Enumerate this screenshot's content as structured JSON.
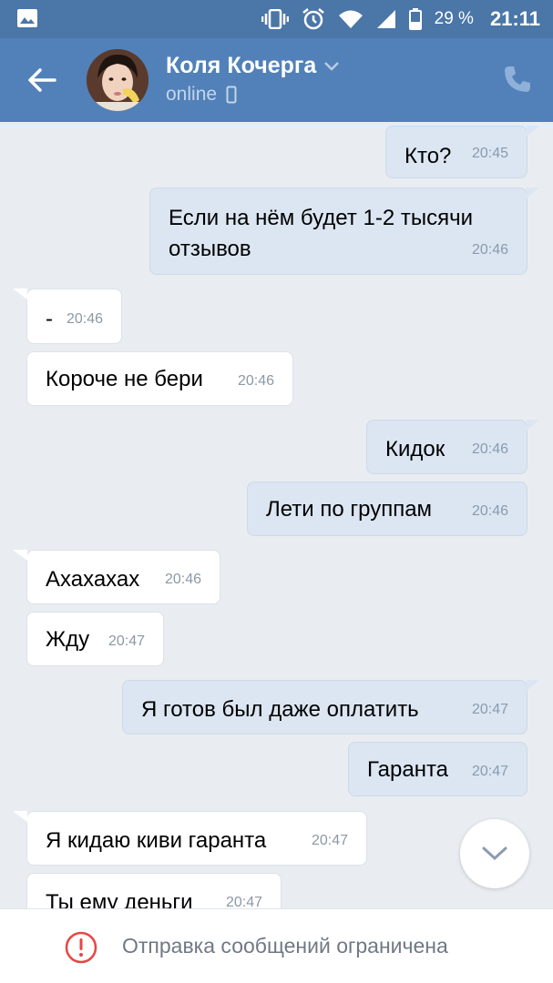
{
  "status_bar": {
    "battery_percent": "29 %",
    "time": "21:11"
  },
  "header": {
    "contact_name": "Коля Кочерга",
    "status": "online"
  },
  "messages": [
    {
      "dir": "out",
      "text": "Кто?",
      "time": "20:45"
    },
    {
      "dir": "out",
      "text": "Если на нём будет 1-2 тысячи отзывов",
      "time": "20:46"
    },
    {
      "dir": "in",
      "text": "-",
      "time": "20:46"
    },
    {
      "dir": "in",
      "text": "Короче не бери",
      "time": "20:46"
    },
    {
      "dir": "out",
      "text": "Кидок",
      "time": "20:46"
    },
    {
      "dir": "out",
      "text": "Лети по группам",
      "time": "20:46"
    },
    {
      "dir": "in",
      "text": "Ахахахах",
      "time": "20:46"
    },
    {
      "dir": "in",
      "text": "Жду",
      "time": "20:47"
    },
    {
      "dir": "out",
      "text": "Я готов был даже оплатить",
      "time": "20:47"
    },
    {
      "dir": "out",
      "text": "Гаранта",
      "time": "20:47"
    },
    {
      "dir": "in",
      "text": "Я кидаю киви гаранта",
      "time": "20:47"
    },
    {
      "dir": "in",
      "text": "Ты ему деньги",
      "time": "20:47"
    }
  ],
  "bottom_bar": {
    "notice": "Отправка сообщений ограничена"
  },
  "colors": {
    "header": "#5181b8",
    "status_bar": "#4a76a8",
    "outgoing_bubble": "#dce6f2",
    "incoming_bubble": "#ffffff",
    "warning": "#e64646"
  }
}
